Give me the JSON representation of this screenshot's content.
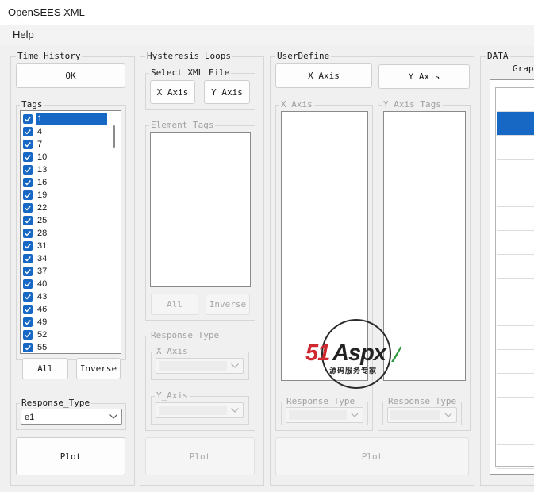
{
  "window": {
    "title": "OpenSEES XML"
  },
  "menu": {
    "help": "Help"
  },
  "time_history": {
    "title": "Time History",
    "ok": "OK",
    "tags_label": "Tags",
    "tags": [
      "1",
      "4",
      "7",
      "10",
      "13",
      "16",
      "19",
      "22",
      "25",
      "28",
      "31",
      "34",
      "37",
      "40",
      "43",
      "46",
      "49",
      "52",
      "55"
    ],
    "selected_tag": "1",
    "all": "All",
    "inverse": "Inverse",
    "response_type_label": "Response_Type",
    "response_type_value": "e1",
    "plot": "Plot"
  },
  "hysteresis": {
    "title": "Hysteresis Loops",
    "select_xml": "Select XML File",
    "x_axis": "X Axis",
    "y_axis": "Y Axis",
    "element_tags": "Element Tags",
    "all": "All",
    "inverse": "Inverse",
    "response_type": "Response_Type",
    "x_axis_label": "X_Axis",
    "y_axis_label": "Y_Axis",
    "plot": "Plot"
  },
  "user_define": {
    "title": "UserDefine",
    "x_axis_btn": "X Axis",
    "y_axis_btn": "Y Axis",
    "x_axis_group": "X Axis",
    "y_axis_tags_group": "Y Axis Tags",
    "response_type_left": "Response_Type",
    "response_type_right": "Response_Type",
    "plot": "Plot"
  },
  "data": {
    "title": "DATA",
    "graph_label": "Grap"
  },
  "watermark": {
    "brand_red": "51",
    "brand_dark": "Aspx",
    "subtitle": "源码服务专家"
  },
  "colors": {
    "accent": "#1668c4",
    "window_bg": "#f0f0f0",
    "brand_red": "#d0282f",
    "brand_green": "#2e9a3c"
  }
}
